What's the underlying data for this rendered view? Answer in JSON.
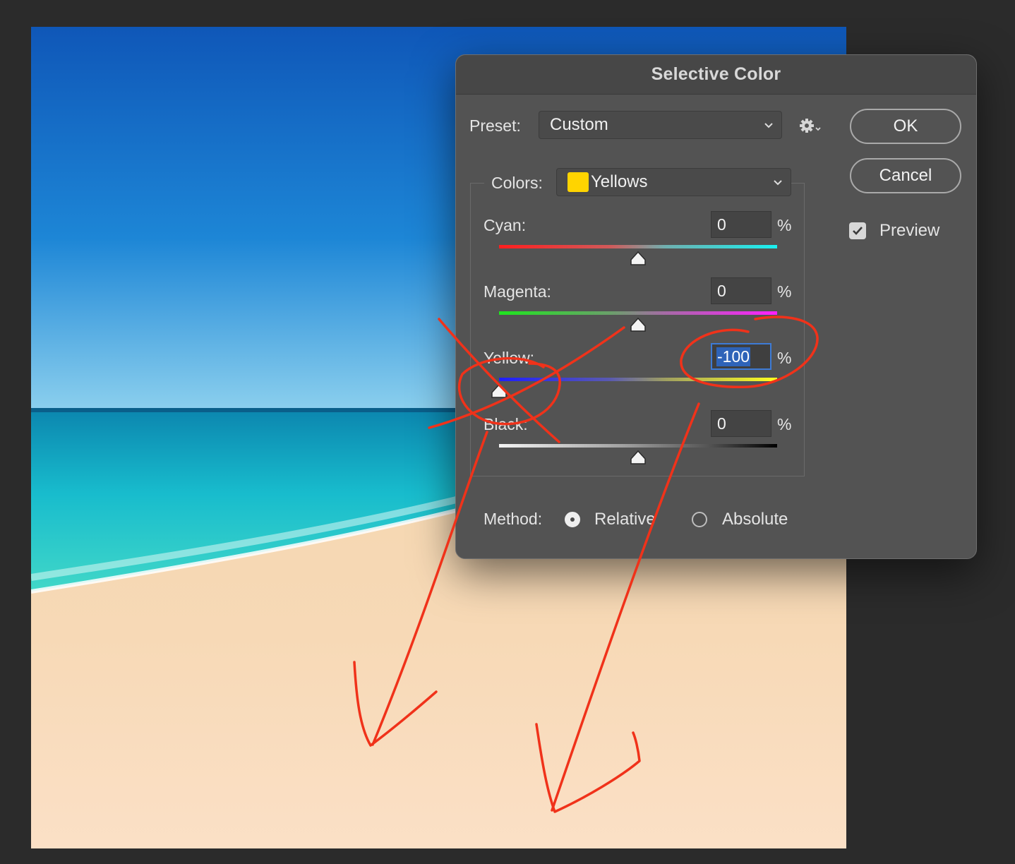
{
  "dialog": {
    "title": "Selective Color",
    "preset_label": "Preset:",
    "preset_value": "Custom",
    "colors_label": "Colors:",
    "colors_value": "Yellows",
    "colors_swatch": "#ffd400",
    "ok_label": "OK",
    "cancel_label": "Cancel",
    "preview_label": "Preview",
    "preview_checked": true,
    "percent_sign": "%",
    "sliders": [
      {
        "label": "Cyan:",
        "value": "0",
        "level": 0.5
      },
      {
        "label": "Magenta:",
        "value": "0",
        "level": 0.5
      },
      {
        "label": "Yellow:",
        "value": "-100",
        "level": 0.0
      },
      {
        "label": "Black:",
        "value": "0",
        "level": 0.5
      }
    ],
    "method_label": "Method:",
    "method_options": [
      "Relative",
      "Absolute"
    ],
    "method_selected": "Relative"
  },
  "colors": {
    "annotation": "#f0321a",
    "focus": "#3d7bd6"
  }
}
